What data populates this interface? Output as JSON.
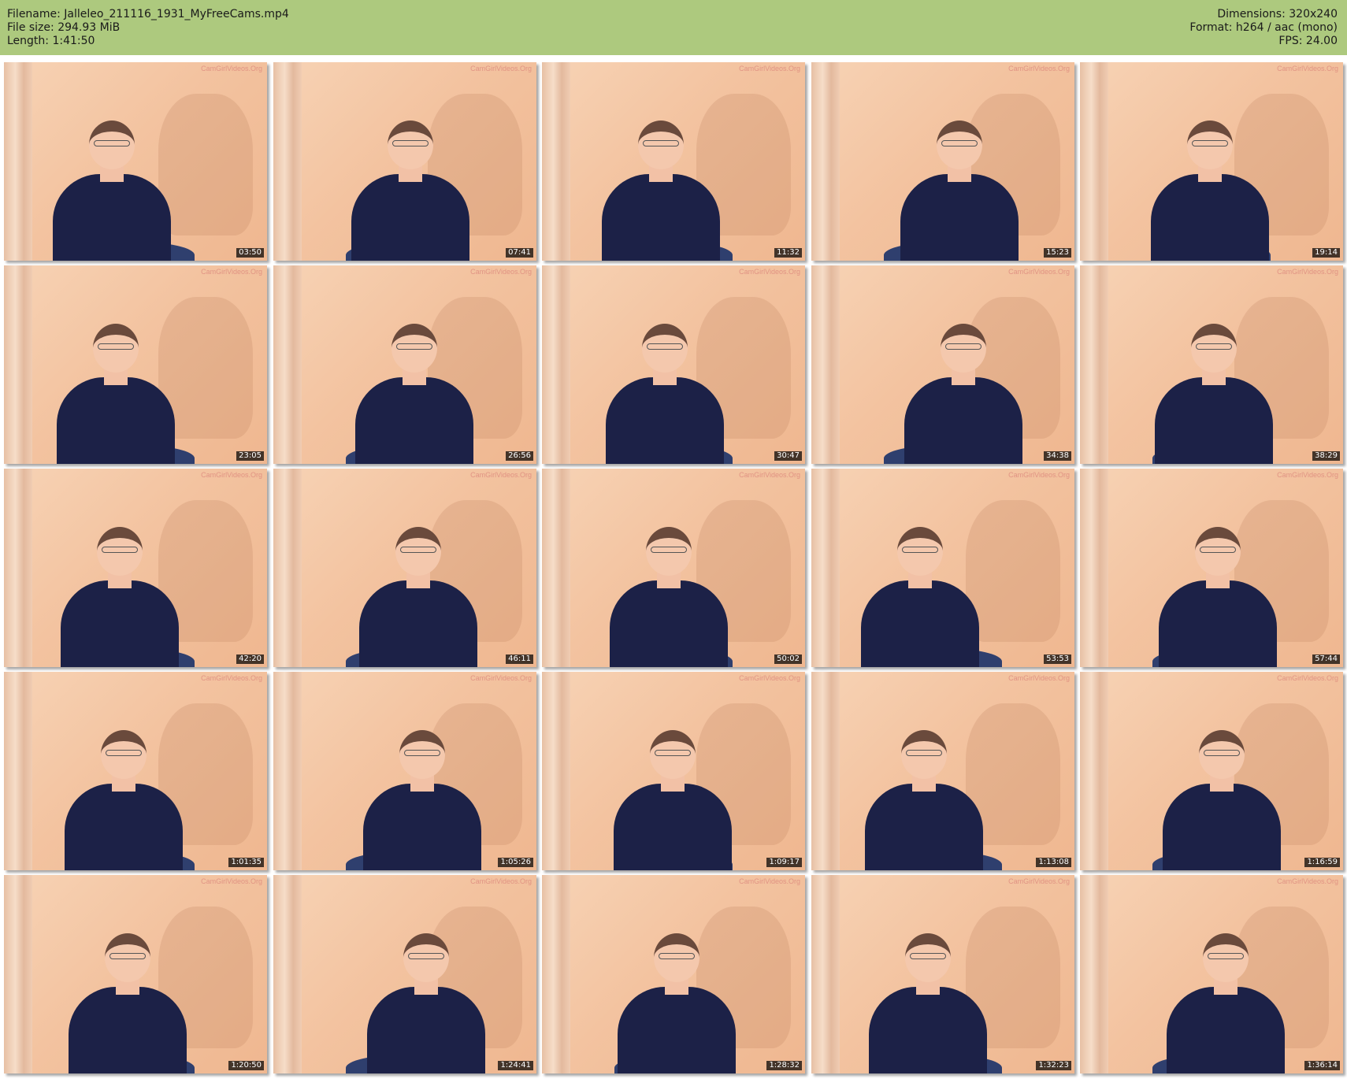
{
  "header": {
    "filename": "Filename: Jalleleo_211116_1931_MyFreeCams.mp4",
    "filesize": "File size: 294.93 MiB",
    "length": "Length: 1:41:50",
    "dimensions": "Dimensions: 320x240",
    "format": "Format: h264 / aac (mono)",
    "fps": "FPS: 24.00"
  },
  "watermark": "CamGirlVideos.Org",
  "colors": {
    "header_bg": "#adc97e",
    "timestamp_bg": "#000000",
    "cardigan": "#1c2147"
  },
  "thumbnails": [
    "03:50",
    "07:41",
    "11:32",
    "15:23",
    "19:14",
    "23:05",
    "26:56",
    "30:47",
    "34:38",
    "38:29",
    "42:20",
    "46:11",
    "50:02",
    "53:53",
    "57:44",
    "1:01:35",
    "1:05:26",
    "1:09:17",
    "1:13:08",
    "1:16:59",
    "1:20:50",
    "1:24:41",
    "1:28:32",
    "1:32:23",
    "1:36:14"
  ]
}
